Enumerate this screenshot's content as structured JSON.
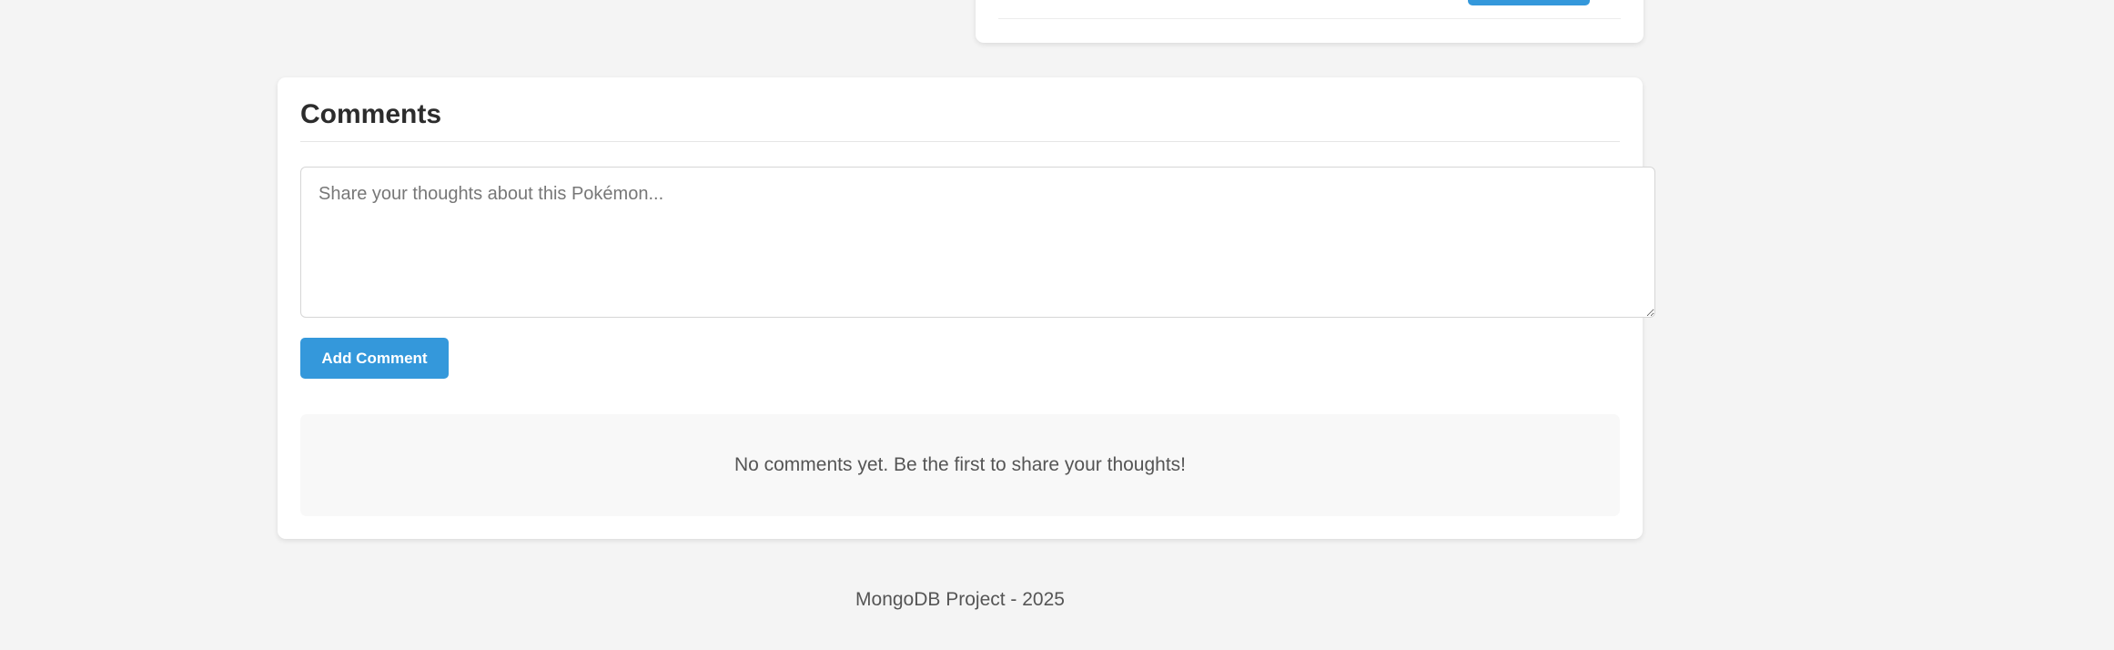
{
  "comments": {
    "title": "Comments",
    "textarea_placeholder": "Share your thoughts about this Pokémon...",
    "textarea_value": "",
    "add_button_label": "Add Comment",
    "empty_message": "No comments yet. Be the first to share your thoughts!"
  },
  "footer": {
    "text": "MongoDB Project - 2025"
  },
  "colors": {
    "background": "#f4f4f4",
    "card": "#ffffff",
    "accent": "#3498db",
    "empty_state_bg": "#f8f8f8",
    "muted_text": "#555555"
  }
}
